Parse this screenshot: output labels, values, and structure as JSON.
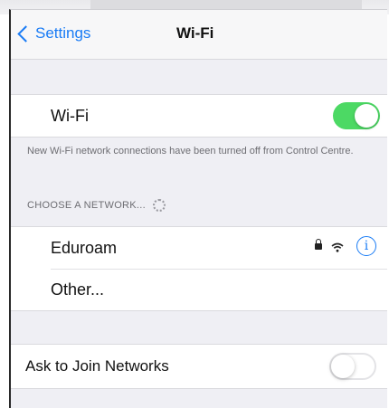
{
  "nav": {
    "back_label": "Settings",
    "title": "Wi-Fi"
  },
  "wifi": {
    "label": "Wi-Fi",
    "enabled": true,
    "toggle_color": "#4cd964"
  },
  "footnote": "New Wi-Fi network connections have been turned off from Control Centre.",
  "networks_section": {
    "header": "CHOOSE A NETWORK...",
    "items": [
      {
        "label": "Eduroam",
        "icons": [
          "lock-icon",
          "wifi-signal-icon",
          "info-icon"
        ]
      },
      {
        "label": "Other..."
      }
    ],
    "info_glyph": "i"
  },
  "ask_to_join": {
    "label": "Ask to Join Networks",
    "enabled": false
  },
  "accent_color": "#1a7cf5"
}
